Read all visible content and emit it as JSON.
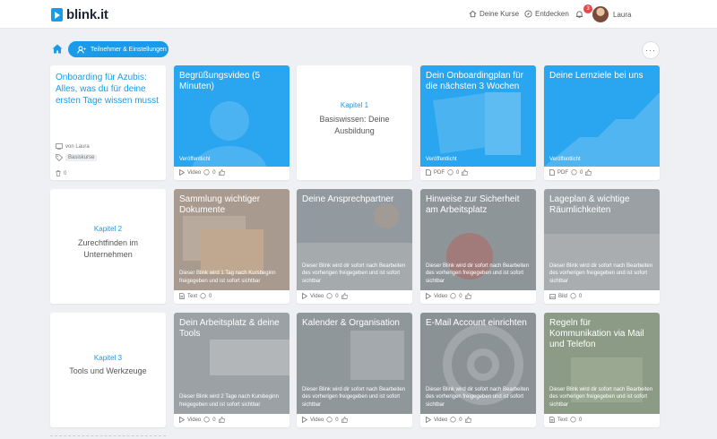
{
  "app": {
    "logo": "blink.it"
  },
  "header": {
    "nav_courses": "Deine Kurse",
    "nav_discover": "Entdecken",
    "notifications_count": "3",
    "user_name": "Laura"
  },
  "toolbar": {
    "participants_label": "Teilnehmer & Einstellungen",
    "more_label": "···"
  },
  "course": {
    "title": "Onboarding für Azubis: Alles, was du für deine ersten Tage wissen musst",
    "author": "von Laura",
    "tag": "Basiskurse",
    "count": "0"
  },
  "chapters": [
    {
      "number": "Kapitel 1",
      "name": "Basiswissen: Deine Ausbildung"
    },
    {
      "number": "Kapitel 2",
      "name": "Zurechtfinden im Unternehmen"
    },
    {
      "number": "Kapitel 3",
      "name": "Tools und Werkzeuge"
    }
  ],
  "blinks": [
    {
      "title": "Begrüßungsvideo (5 Minuten)",
      "status": "Veröffentlicht",
      "type": "Video",
      "comments": "0",
      "likes": ""
    },
    {
      "title": "Dein Onboardingplan für die nächsten 3 Wochen",
      "status": "Veröffentlicht",
      "type": "PDF",
      "comments": "0",
      "likes": ""
    },
    {
      "title": "Deine Lernziele bei uns",
      "status": "Veröffentlicht",
      "type": "PDF",
      "comments": "0",
      "likes": ""
    },
    {
      "title": "Sammlung wichtiger Dokumente",
      "desc": "Dieser Blink wird 1 Tag nach Kursbeginn freigegeben und ist sofort sichtbar",
      "type": "Text",
      "comments": "0",
      "likes": ""
    },
    {
      "title": "Deine Ansprechpartner",
      "desc": "Dieser Blink wird dir sofort nach Bearbeiten des vorherigen freigegeben und ist sofort sichtbar",
      "type": "Video",
      "comments": "0",
      "likes": ""
    },
    {
      "title": "Hinweise zur Sicherheit am Arbeitsplatz",
      "desc": "Dieser Blink wird dir sofort nach Bearbeiten des vorherigen freigegeben und ist sofort sichtbar",
      "type": "Video",
      "comments": "0",
      "likes": ""
    },
    {
      "title": "Lageplan & wichtige Räumlichkeiten",
      "desc": "Dieser Blink wird dir sofort nach Bearbeiten des vorherigen freigegeben und ist sofort sichtbar",
      "type": "Bild",
      "comments": "0",
      "likes": ""
    },
    {
      "title": "Dein Arbeitsplatz & deine Tools",
      "desc": "Dieser Blink wird 2 Tage nach Kursbeginn freigegeben und ist sofort sichtbar",
      "type": "Video",
      "comments": "0",
      "likes": ""
    },
    {
      "title": "Kalender & Organisation",
      "desc": "Dieser Blink wird dir sofort nach Bearbeiten des vorherigen freigegeben und ist sofort sichtbar",
      "type": "Video",
      "comments": "0",
      "likes": ""
    },
    {
      "title": "E-Mail Account einrichten",
      "desc": "Dieser Blink wird dir sofort nach Bearbeiten des vorherigen freigegeben und ist sofort sichtbar",
      "type": "Video",
      "comments": "0",
      "likes": ""
    },
    {
      "title": "Regeln für Kommunikation via Mail und Telefon",
      "desc": "Dieser Blink wird dir sofort nach Bearbeiten des vorherigen freigegeben und ist sofort sichtbar",
      "type": "Text",
      "comments": "0",
      "likes": ""
    }
  ],
  "colors": {
    "accent": "#1a9bea",
    "badge": "#e5474d",
    "background": "#eef0f3"
  }
}
